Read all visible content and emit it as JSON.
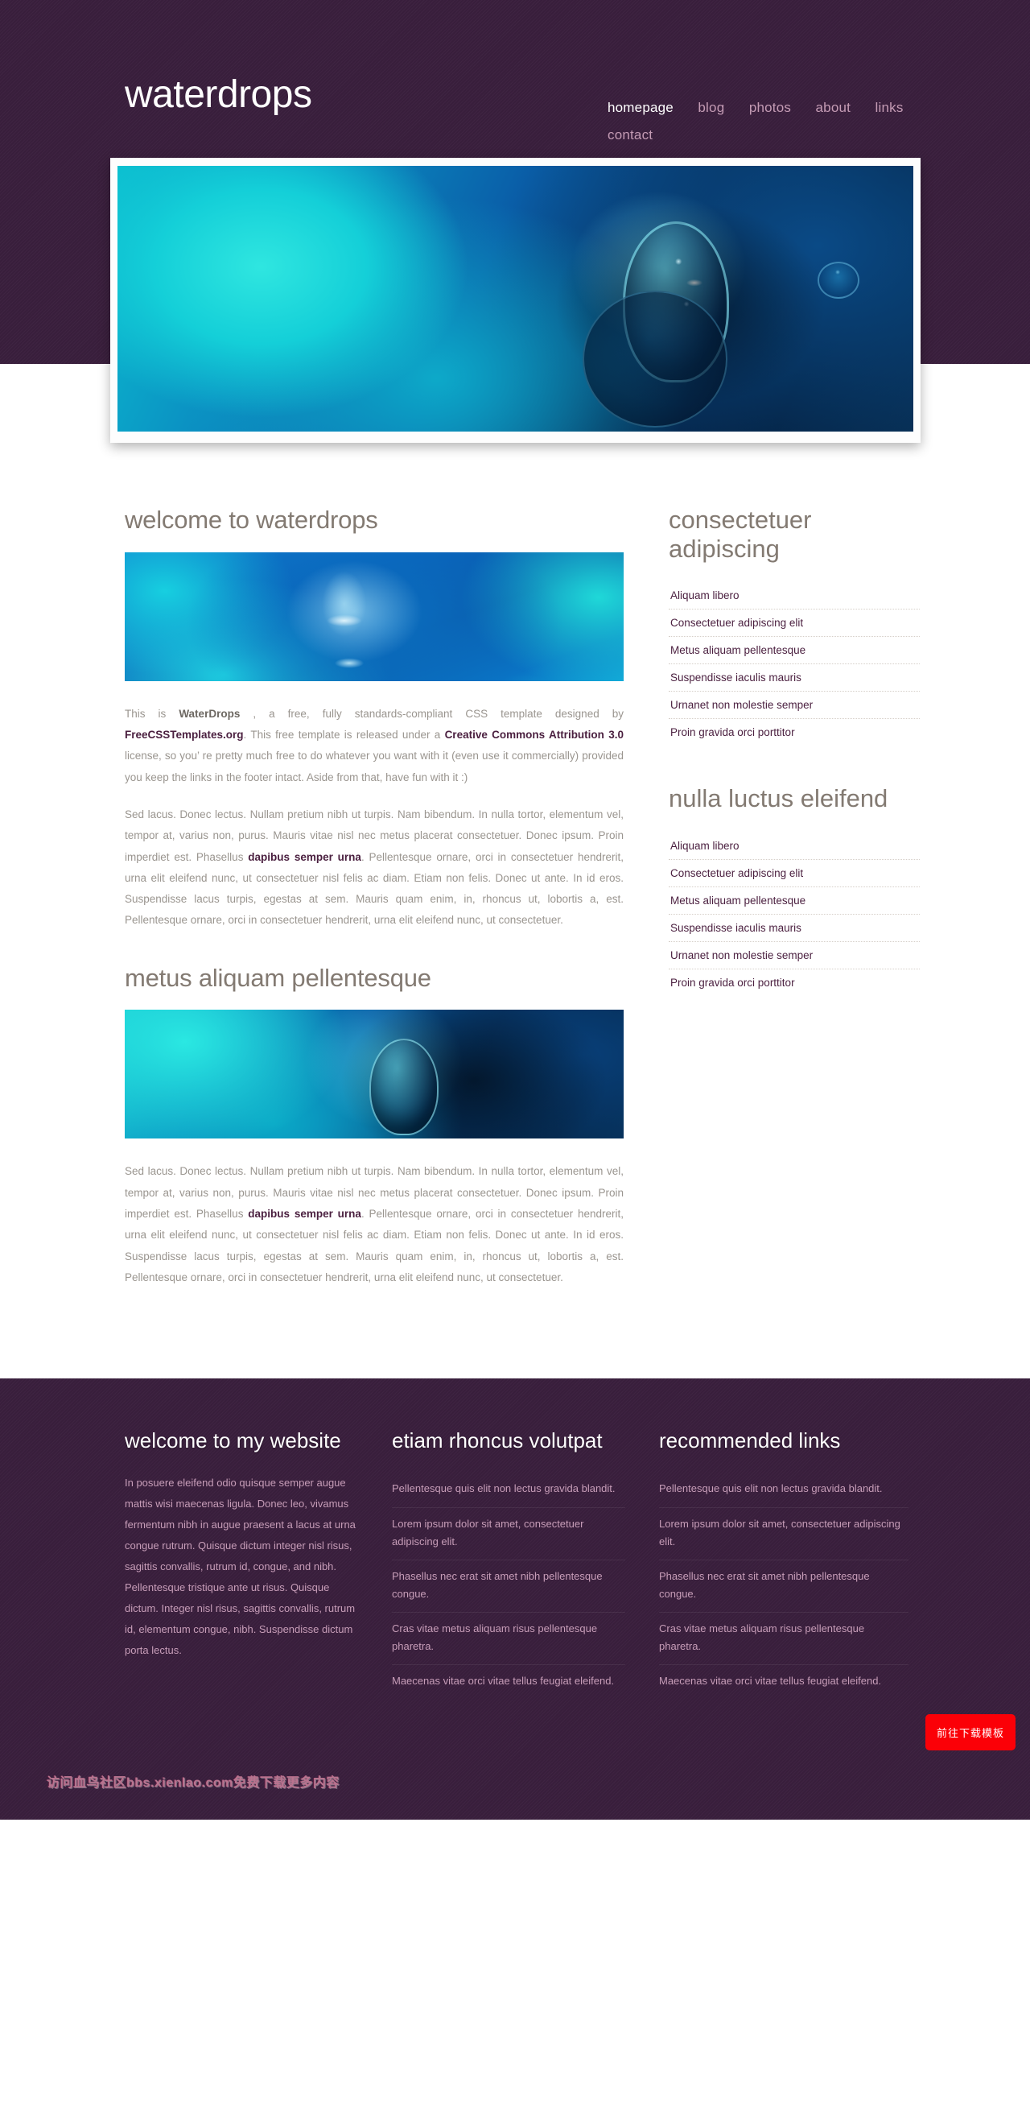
{
  "theme": {
    "purple": "#3a1f3d",
    "heading_gray": "#837a72",
    "body_gray": "#9a958f",
    "link_purple": "#4a1f3f",
    "footer_text": "#c79db8",
    "nav_inactive": "#c49bb4",
    "download_red": "#fb0007"
  },
  "header": {
    "logo": "waterdrops",
    "nav": [
      {
        "label": "homepage",
        "active": true
      },
      {
        "label": "blog",
        "active": false
      },
      {
        "label": "photos",
        "active": false
      },
      {
        "label": "about",
        "active": false
      },
      {
        "label": "links",
        "active": false
      },
      {
        "label": "contact",
        "active": false
      }
    ]
  },
  "main": {
    "section1": {
      "title": "welcome to waterdrops",
      "para1_a": "This is ",
      "para1_bold": "WaterDrops",
      "para1_b": " , a free, fully standards-compliant CSS template designed by ",
      "para1_link1": "FreeCSSTemplates.org",
      "para1_c": ". This free template is released under a ",
      "para1_link2": "Creative Commons Attribution 3.0",
      "para1_d": " license, so you’ re pretty much free to do whatever you want with it (even use it commercially) provided you keep the links in the footer intact. Aside from that, have fun with it :)",
      "para2_a": "Sed lacus. Donec lectus. Nullam pretium nibh ut turpis. Nam bibendum. In nulla tortor, elementum vel, tempor at, varius non, purus. Mauris vitae nisl nec metus placerat consectetuer. Donec ipsum. Proin imperdiet est. Phasellus ",
      "para2_link": "dapibus semper urna",
      "para2_b": ". Pellentesque ornare, orci in consectetuer hendrerit, urna elit eleifend nunc, ut consectetuer nisl felis ac diam. Etiam non felis. Donec ut ante. In id eros. Suspendisse lacus turpis, egestas at sem. Mauris quam enim, in, rhoncus ut, lobortis a, est. Pellentesque ornare, orci in consectetuer hendrerit, urna elit eleifend nunc, ut consectetuer."
    },
    "section2": {
      "title": "metus aliquam pellentesque",
      "para_a": "Sed lacus. Donec lectus. Nullam pretium nibh ut turpis. Nam bibendum. In nulla tortor, elementum vel, tempor at, varius non, purus. Mauris vitae nisl nec metus placerat consectetuer. Donec ipsum. Proin imperdiet est. Phasellus ",
      "para_link": "dapibus semper urna",
      "para_b": ". Pellentesque ornare, orci in consectetuer hendrerit, urna elit eleifend nunc, ut consectetuer nisl felis ac diam. Etiam non felis. Donec ut ante. In id eros. Suspendisse lacus turpis, egestas at sem. Mauris quam enim, in, rhoncus ut, lobortis a, est. Pellentesque ornare, orci in consectetuer hendrerit, urna elit eleifend nunc, ut consectetuer."
    }
  },
  "sidebar": {
    "block1": {
      "title": "consectetuer adipiscing",
      "items": [
        "Aliquam libero",
        "Consectetuer adipiscing elit",
        "Metus aliquam pellentesque",
        "Suspendisse iaculis mauris",
        "Urnanet non molestie semper",
        "Proin gravida orci porttitor"
      ]
    },
    "block2": {
      "title": "nulla luctus eleifend",
      "items": [
        "Aliquam libero",
        "Consectetuer adipiscing elit",
        "Metus aliquam pellentesque",
        "Suspendisse iaculis mauris",
        "Urnanet non molestie semper",
        "Proin gravida orci porttitor"
      ]
    }
  },
  "footer": {
    "col1": {
      "title": "welcome to my website",
      "text": "In posuere eleifend odio quisque semper augue mattis wisi maecenas ligula. Donec leo, vivamus fermentum nibh in augue praesent a lacus at urna congue rutrum. Quisque dictum integer nisl risus, sagittis convallis, rutrum id, congue, and nibh. Pellentesque tristique ante ut risus. Quisque dictum. Integer nisl risus, sagittis convallis, rutrum id, elementum congue, nibh. Suspendisse dictum porta lectus."
    },
    "col2": {
      "title": "etiam rhoncus volutpat",
      "items": [
        "Pellentesque quis elit non lectus gravida blandit.",
        "Lorem ipsum dolor sit amet, consectetuer adipiscing elit.",
        "Phasellus nec erat sit amet nibh pellentesque congue.",
        "Cras vitae metus aliquam risus pellentesque pharetra.",
        "Maecenas vitae orci vitae tellus feugiat eleifend."
      ]
    },
    "col3": {
      "title": "recommended links",
      "items": [
        "Pellentesque quis elit non lectus gravida blandit.",
        "Lorem ipsum dolor sit amet, consectetuer adipiscing elit.",
        "Phasellus nec erat sit amet nibh pellentesque congue.",
        "Cras vitae metus aliquam risus pellentesque pharetra.",
        "Maecenas vitae orci vitae tellus feugiat eleifend."
      ]
    },
    "watermark": "访问血鸟社区bbs.xienlao.com免费下载更多内容",
    "download_button": "前往下载模板"
  }
}
